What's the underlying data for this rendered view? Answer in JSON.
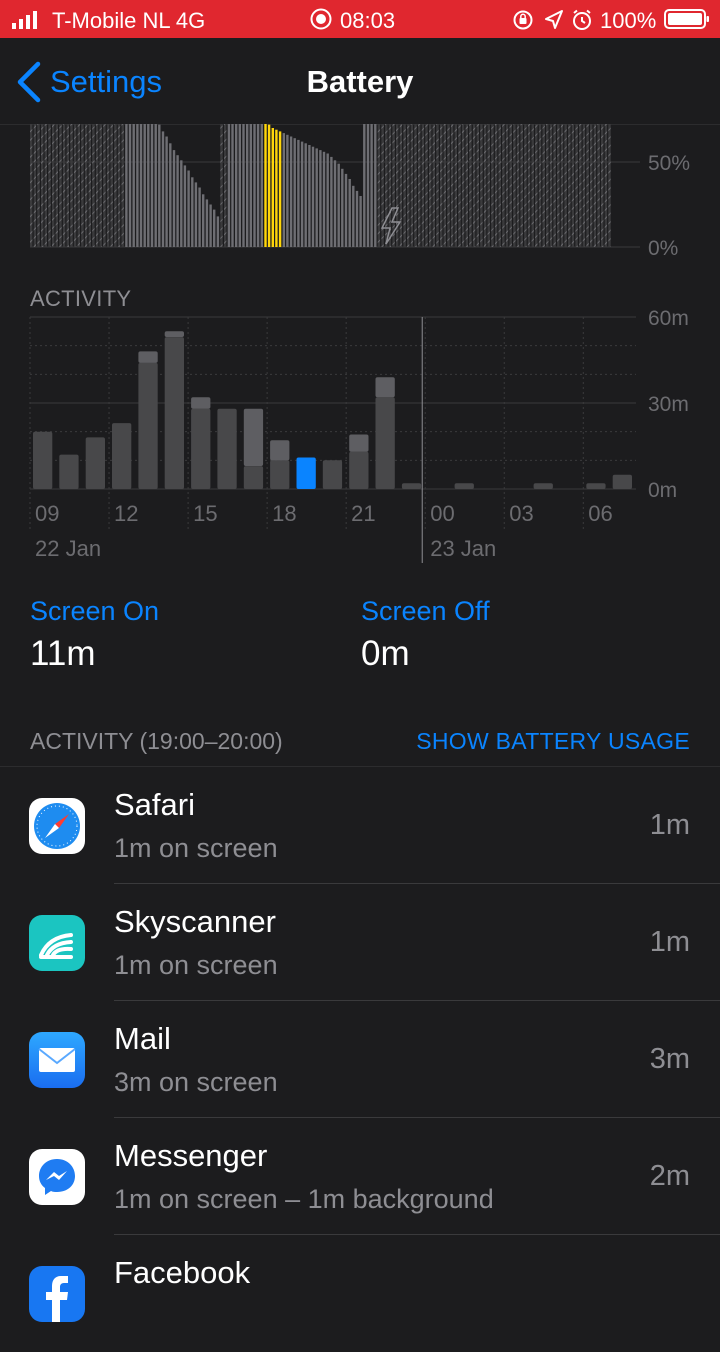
{
  "status_bar": {
    "carrier": "T-Mobile NL  4G",
    "time": "08:03",
    "battery_percent": "100%"
  },
  "nav": {
    "back_label": "Settings",
    "title": "Battery"
  },
  "battery_level_chart": {
    "y_tick_labels": [
      "50%",
      "0%"
    ]
  },
  "activity_section": {
    "label": "ACTIVITY",
    "screen_on_label": "Screen On",
    "screen_on_value": "11m",
    "screen_off_label": "Screen Off",
    "screen_off_value": "0m"
  },
  "usage_list": {
    "header": "ACTIVITY (19:00–20:00)",
    "show_usage_link": "SHOW BATTERY USAGE",
    "apps": [
      {
        "name": "Safari",
        "detail": "1m on screen",
        "time": "1m",
        "icon": "safari-icon"
      },
      {
        "name": "Skyscanner",
        "detail": "1m on screen",
        "time": "1m",
        "icon": "skyscanner-icon"
      },
      {
        "name": "Mail",
        "detail": "3m on screen",
        "time": "3m",
        "icon": "mail-icon"
      },
      {
        "name": "Messenger",
        "detail": "1m on screen – 1m background",
        "time": "2m",
        "icon": "messenger-icon"
      },
      {
        "name": "Facebook",
        "detail": "",
        "time": "",
        "icon": "facebook-icon"
      }
    ]
  },
  "colors": {
    "background": "#1c1c1e",
    "status_bar": "#e0272f",
    "accent_blue": "#0a84ff",
    "highlight_yellow": "#ffd60a",
    "bar_grey": "#48484a",
    "secondary_text": "#8e8e93"
  },
  "chart_data": [
    {
      "type": "bar",
      "name": "battery-level",
      "y_unit": "%",
      "ylim": [
        0,
        100
      ],
      "y_ticks": [
        "50%",
        "0%"
      ],
      "series": [
        {
          "name": "",
          "values": [
            100,
            100,
            100,
            100,
            100,
            100,
            100,
            100,
            100,
            100,
            100,
            100,
            100,
            100,
            100,
            100,
            100,
            100,
            100,
            100,
            100,
            100,
            100,
            100,
            100,
            100,
            100,
            100,
            100,
            97,
            92,
            88,
            84,
            80,
            76,
            72,
            68,
            65,
            61,
            57,
            54,
            51,
            48,
            45,
            41,
            38,
            35,
            31,
            28,
            25,
            22,
            18,
            100,
            100,
            90,
            88,
            86,
            84,
            82,
            80,
            78,
            77,
            75,
            74,
            73,
            72,
            70,
            69,
            68,
            67,
            66,
            65,
            64,
            63,
            62,
            61,
            60,
            59,
            58,
            57,
            56,
            55,
            53,
            51,
            49,
            46,
            43,
            40,
            36,
            33,
            30,
            100,
            100,
            100,
            100,
            100,
            100,
            100,
            100,
            100,
            100,
            100,
            100,
            100,
            100,
            100,
            100,
            100,
            100,
            100,
            100,
            100,
            100,
            100,
            100,
            100,
            100,
            100,
            100,
            100,
            100,
            100,
            100,
            100,
            100,
            100,
            100,
            100,
            100,
            100,
            100,
            100,
            100,
            100,
            100,
            100,
            100,
            100,
            100,
            100,
            100,
            100,
            100,
            100,
            100,
            100,
            100,
            100,
            100,
            100,
            100,
            100,
            100,
            100,
            100,
            100,
            100,
            100,
            100
          ]
        },
        {
          "name": "",
          "highlighted_hour": "19",
          "values_highlighted": [
            75,
            74,
            73,
            72,
            70
          ]
        }
      ]
    },
    {
      "type": "bar",
      "name": "activity",
      "y_unit": "m",
      "ylim": [
        0,
        60
      ],
      "y_ticks": [
        "60m",
        "30m",
        "0m"
      ],
      "categories": [
        "09",
        "10",
        "11",
        "12",
        "13",
        "14",
        "15",
        "16",
        "17",
        "18",
        "19",
        "20",
        "21",
        "22",
        "23",
        "00",
        "01",
        "02",
        "03",
        "04",
        "05",
        "06",
        "07"
      ],
      "x_tick_labels": [
        "09",
        "12",
        "15",
        "18",
        "21",
        "00",
        "03",
        "06"
      ],
      "date_labels": [
        "22 Jan",
        "23 Jan"
      ],
      "series": [
        {
          "name": "Screen On",
          "values": [
            20,
            12,
            18,
            23,
            44,
            53,
            28,
            28,
            8,
            10,
            11,
            10,
            13,
            32,
            2,
            0,
            2,
            0,
            0,
            2,
            0,
            2,
            5
          ]
        },
        {
          "name": "Screen Off",
          "values": [
            0,
            0,
            0,
            0,
            4,
            2,
            4,
            0,
            20,
            7,
            0,
            0,
            6,
            7,
            0,
            0,
            0,
            0,
            0,
            0,
            0,
            0,
            0
          ]
        }
      ],
      "highlighted_category": "19"
    }
  ]
}
